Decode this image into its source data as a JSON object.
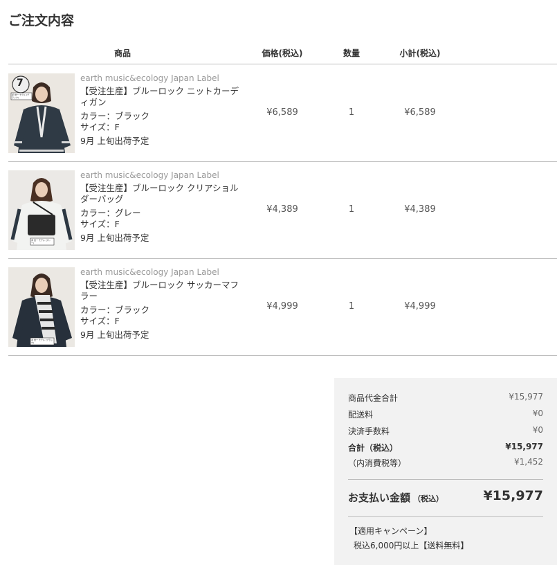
{
  "page": {
    "title": "ご注文内容"
  },
  "table": {
    "headers": {
      "product": "商品",
      "price": "価格(税込)",
      "qty": "数量",
      "subtotal": "小計(税込)"
    },
    "items": [
      {
        "brand": "earth music&ecology Japan Label",
        "name": "【受注生産】ブルーロック ニットカーディガン",
        "color": "カラー：ブラック",
        "size": "サイズ：F",
        "ship": "9月 上旬出荷予定",
        "price": "¥6,589",
        "qty": "1",
        "subtotal": "¥6,589",
        "thumb_badge": "7",
        "thumb_caption": "潔 世一 モデル (ブラック)"
      },
      {
        "brand": "earth music&ecology Japan Label",
        "name": "【受注生産】ブルーロック クリアショルダーバッグ",
        "color": "カラー：グレー",
        "size": "サイズ：F",
        "ship": "9月 上旬出荷予定",
        "price": "¥4,389",
        "qty": "1",
        "subtotal": "¥4,389",
        "thumb_caption": "潔 世一 モデル (グレー)"
      },
      {
        "brand": "earth music&ecology Japan Label",
        "name": "【受注生産】ブルーロック サッカーマフラー",
        "color": "カラー：ブラック",
        "size": "サイズ：F",
        "ship": "9月 上旬出荷予定",
        "price": "¥4,999",
        "qty": "1",
        "subtotal": "¥4,999",
        "thumb_caption": "潔 世一 モデル (ブラック)"
      }
    ]
  },
  "summary": {
    "goods_total_label": "商品代金合計",
    "goods_total": "¥15,977",
    "shipping_label": "配送料",
    "shipping": "¥0",
    "fee_label": "決済手数料",
    "fee": "¥0",
    "total_label": "合計（税込）",
    "total": "¥15,977",
    "tax_label": "（内消費税等）",
    "tax": "¥1,452",
    "grand_label": "お支払い金額",
    "grand_label_small": "（税込）",
    "grand": "¥15,977",
    "campaign_title": "【適用キャンペーン】",
    "campaign_text": "税込6,000円以上【送料無料】"
  },
  "colors": {
    "divider": "#bdbdbd",
    "summary_bg": "#f2f2f2",
    "text": "#333333",
    "muted": "#999999"
  }
}
